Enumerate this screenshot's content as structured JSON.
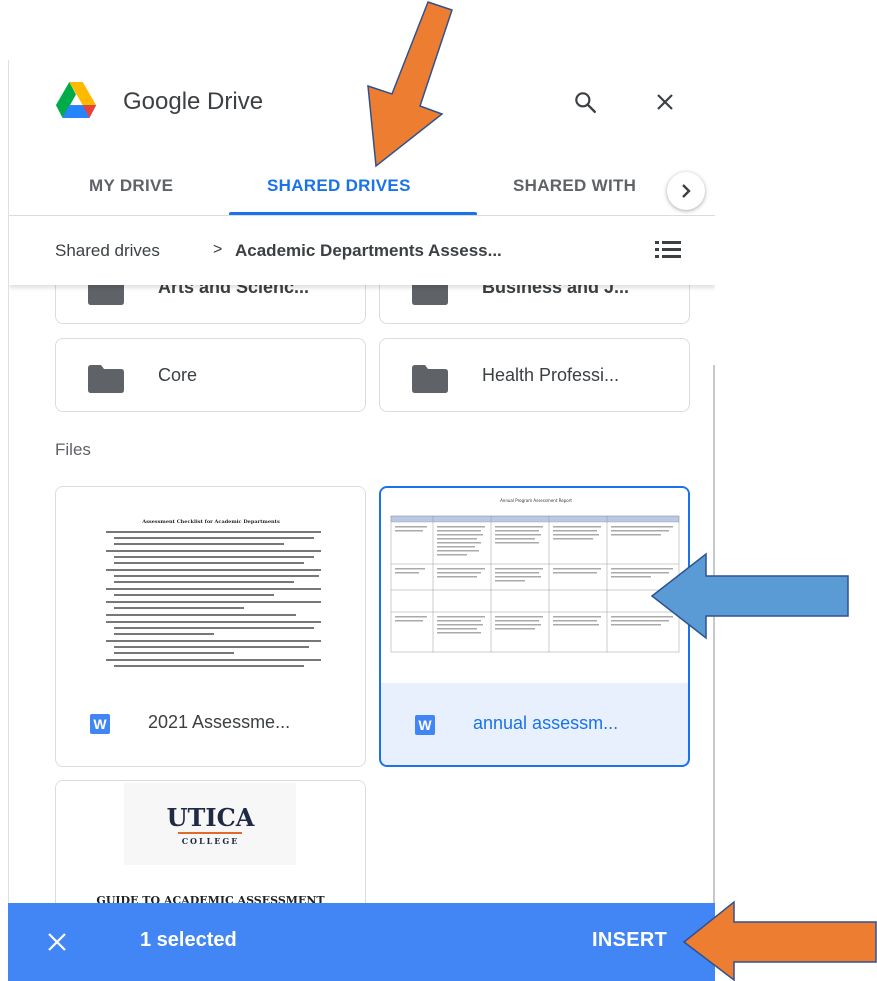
{
  "header": {
    "app_name": "Google Drive",
    "logo_icon": "google-drive-logo",
    "search_icon": "search-icon",
    "close_icon": "close-icon"
  },
  "tabs": [
    {
      "label": "MY DRIVE",
      "active": false
    },
    {
      "label": "SHARED DRIVES",
      "active": true
    },
    {
      "label": "SHARED WITH",
      "active": false
    }
  ],
  "breadcrumb": {
    "root": "Shared drives",
    "separator": ">",
    "current": "Academic Departments Assess..."
  },
  "folders": [
    {
      "name": "Arts and Scienc..."
    },
    {
      "name": "Business and J..."
    },
    {
      "name": "Core"
    },
    {
      "name": "Health Professi..."
    }
  ],
  "files_section": {
    "label": "Files",
    "files": [
      {
        "name": "2021 Assessme...",
        "type_badge": "W",
        "selected": false
      },
      {
        "name": "annual assessm...",
        "type_badge": "W",
        "selected": true
      },
      {
        "name": "",
        "type_badge": "",
        "selected": false
      }
    ],
    "thumb_text": {
      "checklist_title": "Assessment Checklist for Academic Departments",
      "report_title": "Annual Program Assessment Report",
      "utica_line1": "UTICA",
      "utica_line2": "COLLEGE",
      "guide_title": "GUIDE TO ACADEMIC ASSESSMENT"
    }
  },
  "action_bar": {
    "selected_text": "1 selected",
    "insert_label": "INSERT"
  },
  "colors": {
    "accent": "#1a73e8",
    "action_bar": "#4285f4",
    "annotation_orange": "#ed7d31",
    "annotation_blue": "#5b9bd5"
  }
}
